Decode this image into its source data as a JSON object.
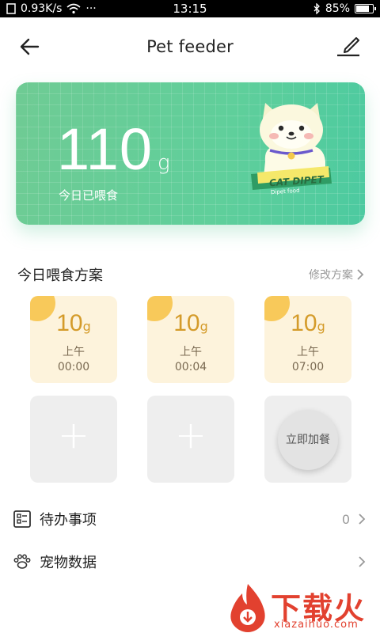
{
  "status_bar": {
    "net_speed": "0.93K/s",
    "time": "13:15",
    "battery": "85%",
    "battery_level": 0.85
  },
  "header": {
    "title": "Pet feeder"
  },
  "hero": {
    "amount": "110",
    "unit": "g",
    "subtitle": "今日已喂食",
    "mascot_brand": "CAT DIPET",
    "mascot_sub": "Dipet food"
  },
  "plan": {
    "title": "今日喂食方案",
    "edit_label": "修改方案",
    "items": [
      {
        "amount": "10",
        "unit": "g",
        "period": "上午",
        "time": "00:00"
      },
      {
        "amount": "10",
        "unit": "g",
        "period": "上午",
        "time": "00:04"
      },
      {
        "amount": "10",
        "unit": "g",
        "period": "上午",
        "time": "07:00"
      }
    ],
    "add_label": "+",
    "feed_now_label": "立即加餐"
  },
  "rows": {
    "todo_label": "待办事项",
    "todo_count": "0",
    "pet_data_label": "宠物数据"
  },
  "watermark": {
    "title": "下载火",
    "url": "xiazaihuo.com"
  },
  "colors": {
    "hero_green": "#5fcf9b",
    "plan_tile": "#fdf3dc",
    "plan_accent": "#d49b2a",
    "sun": "#f8c95a",
    "watermark_red": "#e2412f"
  }
}
